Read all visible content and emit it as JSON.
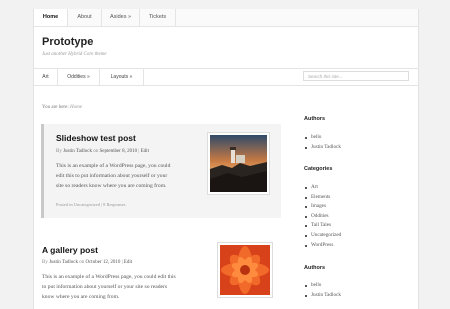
{
  "primary_nav": {
    "items": [
      "Home",
      "About",
      "Asides »",
      "Tickets"
    ]
  },
  "site": {
    "title": "Prototype",
    "description": "Just another Hybrid Core theme"
  },
  "secondary_nav": {
    "items": [
      "Art",
      "Oddities »",
      "Layouts »"
    ]
  },
  "search": {
    "placeholder": "Search this site..."
  },
  "breadcrumb": {
    "prefix": "You are here:",
    "home": "Home"
  },
  "posts": [
    {
      "title": "Slideshow test post",
      "meta": {
        "by": "By",
        "author": "Justin Tadlock",
        "on": "on",
        "date": "September 8, 2010",
        "sep": "|",
        "edit": "Edit"
      },
      "body": [
        "This is an example of a WordPress page, you could",
        "edit this to put information about yourself or your",
        "site so readers know where you are coming from."
      ],
      "footer": "Posted in Uncategorized | 8 Responses"
    },
    {
      "title": "A gallery post",
      "meta": {
        "by": "By",
        "author": "Justin Tadlock",
        "on": "on",
        "date": "October 12, 2010",
        "sep": "|",
        "edit": "Edit"
      },
      "body": [
        "This is an example of a WordPress page, you could edit this",
        "to put information about yourself or your site so readers",
        "know where you are coming from."
      ]
    }
  ],
  "sidebar": {
    "authors_title": "Authors",
    "authors": [
      "bello",
      "Justin Tadlock"
    ],
    "categories_title": "Categories",
    "categories": [
      "Art",
      "Elements",
      "Images",
      "Oddities",
      "Tall Tales",
      "Uncategorized",
      "WordPress"
    ],
    "authors2_title": "Authors",
    "authors2": [
      "bello",
      "Justin Tadlock"
    ]
  }
}
